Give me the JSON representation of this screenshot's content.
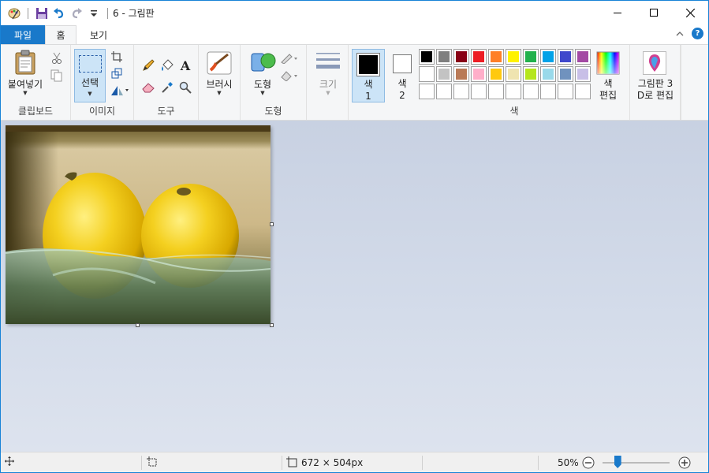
{
  "app": {
    "title": "6 - 그림판"
  },
  "tabs": {
    "file": "파일",
    "home": "홈",
    "view": "보기"
  },
  "ribbon": {
    "clipboard": {
      "paste": "붙여넣기",
      "group": "클립보드"
    },
    "image": {
      "select": "선택",
      "group": "이미지"
    },
    "tools": {
      "group": "도구"
    },
    "brushes": {
      "label": "브러시"
    },
    "shapes": {
      "label": "도형",
      "group": "도형"
    },
    "size": {
      "label": "크기"
    },
    "colors": {
      "color1": "색\n1",
      "color2": "색\n2",
      "edit": "색\n편집",
      "group": "색",
      "palette_row1": [
        "#000000",
        "#7f7f7f",
        "#880015",
        "#ed1c24",
        "#ff7f27",
        "#fff200",
        "#22b14c",
        "#00a2e8",
        "#3f48cc",
        "#a349a4"
      ],
      "palette_row2": [
        "#ffffff",
        "#c3c3c3",
        "#b97a57",
        "#ffaec9",
        "#ffc90e",
        "#efe4b0",
        "#b5e61d",
        "#99d9ea",
        "#7092be",
        "#c8bfe7"
      ],
      "palette_row3": [
        "#ffffff",
        "#ffffff",
        "#ffffff",
        "#ffffff",
        "#ffffff",
        "#ffffff",
        "#ffffff",
        "#ffffff",
        "#ffffff",
        "#ffffff"
      ],
      "color1_value": "#000000",
      "color2_value": "#ffffff"
    },
    "paint3d": {
      "label": "그림판 3\nD로 편집"
    }
  },
  "status": {
    "image_size": "672 × 504px",
    "zoom": "50%",
    "zoom_fraction": 0.5
  },
  "icons": [
    "move-icon",
    "selection-size-icon",
    "image-size-icon",
    "zoom-out-icon",
    "zoom-in-icon",
    "help-icon",
    "collapse-ribbon-icon"
  ]
}
